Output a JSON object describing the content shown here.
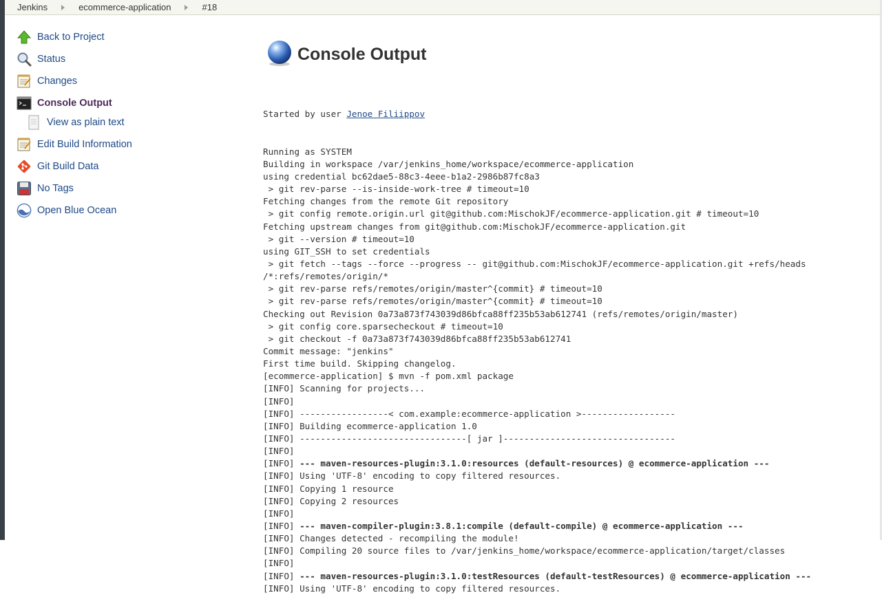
{
  "breadcrumb": {
    "items": [
      "Jenkins",
      "ecommerce-application",
      "#18"
    ]
  },
  "sidebar": {
    "items": [
      {
        "label": "Back to Project",
        "icon": "up-arrow-icon"
      },
      {
        "label": "Status",
        "icon": "magnifier-icon"
      },
      {
        "label": "Changes",
        "icon": "notepad-icon"
      },
      {
        "label": "Console Output",
        "icon": "terminal-icon"
      },
      {
        "label": "View as plain text",
        "icon": "document-icon"
      },
      {
        "label": "Edit Build Information",
        "icon": "notepad-icon"
      },
      {
        "label": "Git Build Data",
        "icon": "git-icon"
      },
      {
        "label": "No Tags",
        "icon": "floppy-icon"
      },
      {
        "label": "Open Blue Ocean",
        "icon": "blue-ocean-icon"
      }
    ]
  },
  "main": {
    "title": "Console Output",
    "started_prefix": "Started by user ",
    "started_user": "Jenoe Filiippov",
    "lines": [
      "Running as SYSTEM",
      "Building in workspace /var/jenkins_home/workspace/ecommerce-application",
      "using credential bc62dae5-88c3-4eee-b1a2-2986b87fc8a3",
      " > git rev-parse --is-inside-work-tree # timeout=10",
      "Fetching changes from the remote Git repository",
      " > git config remote.origin.url git@github.com:MischokJF/ecommerce-application.git # timeout=10",
      "Fetching upstream changes from git@github.com:MischokJF/ecommerce-application.git",
      " > git --version # timeout=10",
      "using GIT_SSH to set credentials",
      " > git fetch --tags --force --progress -- git@github.com:MischokJF/ecommerce-application.git +refs/heads",
      "/*:refs/remotes/origin/*",
      " > git rev-parse refs/remotes/origin/master^{commit} # timeout=10",
      " > git rev-parse refs/remotes/origin/master^{commit} # timeout=10",
      "Checking out Revision 0a73a873f743039d86bfca88ff235b53ab612741 (refs/remotes/origin/master)",
      " > git config core.sparsecheckout # timeout=10",
      " > git checkout -f 0a73a873f743039d86bfca88ff235b53ab612741",
      "Commit message: \"jenkins\"",
      "First time build. Skipping changelog.",
      "[ecommerce-application] $ mvn -f pom.xml package",
      "[INFO] Scanning for projects...",
      "[INFO]",
      "[INFO] -----------------< com.example:ecommerce-application >------------------",
      "[INFO] Building ecommerce-application 1.0",
      "[INFO] --------------------------------[ jar ]---------------------------------",
      "[INFO]",
      {
        "prefix": "[INFO] ",
        "bold": "--- maven-resources-plugin:3.1.0:resources (default-resources) @ ecommerce-application ---"
      },
      "[INFO] Using 'UTF-8' encoding to copy filtered resources.",
      "[INFO] Copying 1 resource",
      "[INFO] Copying 2 resources",
      "[INFO]",
      {
        "prefix": "[INFO] ",
        "bold": "--- maven-compiler-plugin:3.8.1:compile (default-compile) @ ecommerce-application ---"
      },
      "[INFO] Changes detected - recompiling the module!",
      "[INFO] Compiling 20 source files to /var/jenkins_home/workspace/ecommerce-application/target/classes",
      "[INFO]",
      {
        "prefix": "[INFO] ",
        "bold": "--- maven-resources-plugin:3.1.0:testResources (default-testResources) @ ecommerce-application ---"
      },
      "[INFO] Using 'UTF-8' encoding to copy filtered resources."
    ]
  }
}
